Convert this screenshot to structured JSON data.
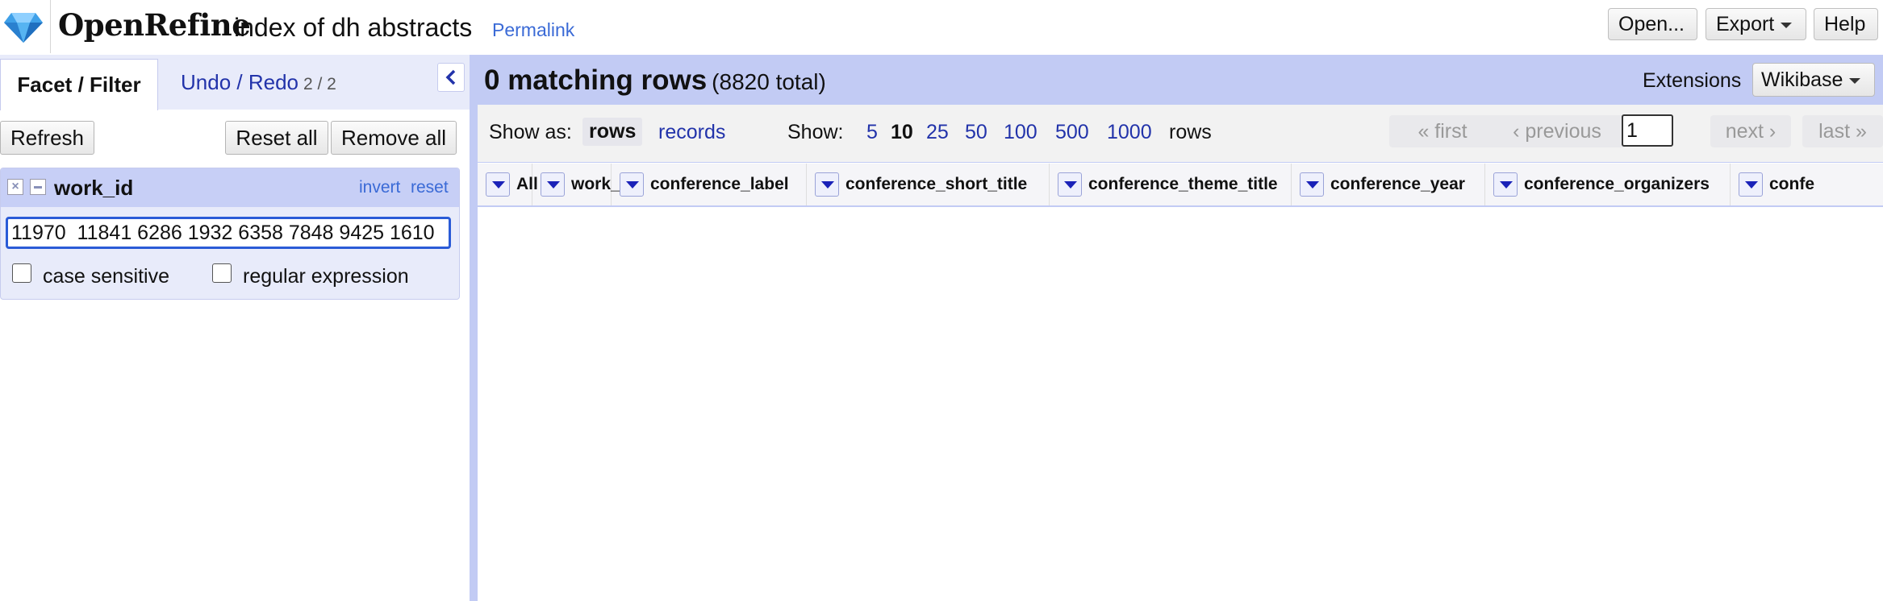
{
  "header": {
    "app_name": "OpenRefine",
    "project_title": "index of dh abstracts",
    "permalink_label": "Permalink",
    "buttons": {
      "open": "Open...",
      "export": "Export",
      "help": "Help"
    }
  },
  "left_panel": {
    "tabs": {
      "facet_filter": "Facet / Filter",
      "undo_redo": "Undo / Redo",
      "undo_redo_count": "2 / 2"
    },
    "buttons": {
      "refresh": "Refresh",
      "reset_all": "Reset all",
      "remove_all": "Remove all"
    },
    "facet": {
      "title": "work_id",
      "invert": "invert",
      "reset": "reset",
      "query_value": "11970  11841 6286 1932 6358 7848 9425 1610",
      "case_sensitive_label": "case sensitive",
      "regex_label": "regular expression"
    }
  },
  "right_panel": {
    "summary": {
      "matching": "0 matching rows",
      "total": "(8820 total)",
      "extensions_label": "Extensions",
      "wikibase_label": "Wikibase"
    },
    "controls": {
      "show_as_label": "Show as:",
      "rows_mode": "rows",
      "records_mode": "records",
      "show_label": "Show:",
      "page_sizes": [
        "5",
        "10",
        "25",
        "50",
        "100",
        "500",
        "1000"
      ],
      "active_page_size": "10",
      "rows_label": "rows",
      "first": "« first",
      "previous": "‹ previous",
      "page_value": "1",
      "next": "next ›",
      "last": "last »"
    },
    "columns": [
      "All",
      "work_id",
      "conference_label",
      "conference_short_title",
      "conference_theme_title",
      "conference_year",
      "conference_organizers",
      "confe"
    ]
  },
  "colors": {
    "accent_blue": "#c2cbf4",
    "link_blue": "#2233aa",
    "facet_bg": "#e8ebfa",
    "input_focus": "#2a5bd7"
  }
}
